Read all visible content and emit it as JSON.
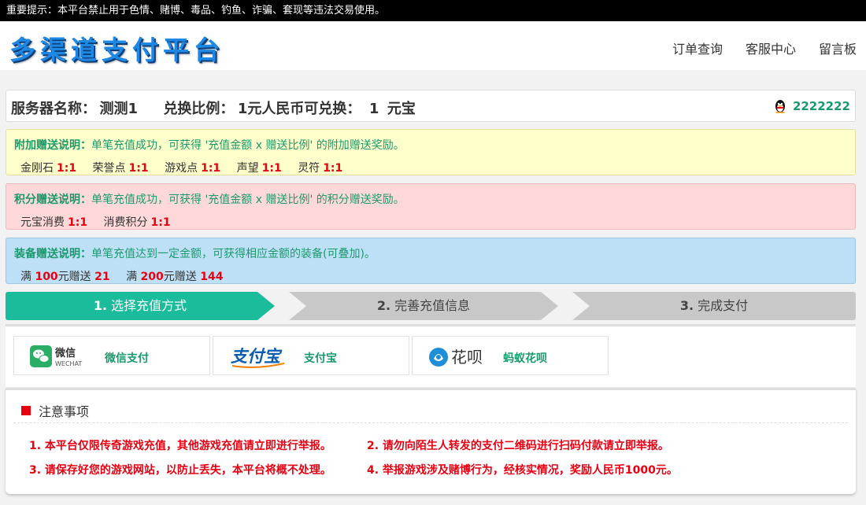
{
  "notice": "重要提示：本平台禁止用于色情、赌博、毒品、钓鱼、诈骗、套现等违法交易使用。",
  "header": {
    "logo": "多渠道支付平台",
    "nav": [
      "订单查询",
      "客服中心",
      "留言板"
    ]
  },
  "server": {
    "name_label": "服务器名称：",
    "name_value": "测测1",
    "ratio_label": "兑换比例：",
    "ratio_text": "1元人民币可兑换：",
    "ratio_value": "1",
    "ratio_unit": "元宝",
    "qq": "2222222"
  },
  "bonus_extra": {
    "title": "附加赠送说明：",
    "desc": "单笔充值成功，可获得 '充值金额 x 赠送比例' 的附加赠送奖励。",
    "items": [
      {
        "name": "金刚石",
        "ratio": "1:1"
      },
      {
        "name": "荣誉点",
        "ratio": "1:1"
      },
      {
        "name": "游戏点",
        "ratio": "1:1"
      },
      {
        "name": "声望",
        "ratio": "1:1"
      },
      {
        "name": "灵符",
        "ratio": "1:1"
      }
    ]
  },
  "bonus_points": {
    "title": "积分赠送说明：",
    "desc": "单笔充值成功，可获得 '充值金额 x 赠送比例' 的积分赠送奖励。",
    "items": [
      {
        "name": "元宝消费",
        "ratio": "1:1"
      },
      {
        "name": "消费积分",
        "ratio": "1:1"
      }
    ]
  },
  "bonus_equip": {
    "title": "装备赠送说明：",
    "desc": "单笔充值达到一定金额，可获得相应金额的装备(可叠加)。",
    "items": [
      {
        "pre": "满",
        "amount": "100",
        "mid": "元赠送",
        "gift": "21"
      },
      {
        "pre": "满",
        "amount": "200",
        "mid": "元赠送",
        "gift": "144"
      }
    ]
  },
  "steps": [
    {
      "num": "1.",
      "label": "选择充值方式"
    },
    {
      "num": "2.",
      "label": "完善充值信息"
    },
    {
      "num": "3.",
      "label": "完成支付"
    }
  ],
  "payments": [
    {
      "label": "微信支付",
      "logo_main": "微信",
      "logo_sub": "WECHAT"
    },
    {
      "label": "支付宝",
      "logo_main": "支付宝"
    },
    {
      "label": "蚂蚁花呗",
      "logo_main": "花呗"
    }
  ],
  "notes": {
    "title": "注意事项",
    "items": [
      "1. 本平台仅限传奇游戏充值，其他游戏充值请立即进行举报。",
      "2. 请勿向陌生人转发的支付二维码进行扫码付款请立即举报。",
      "3. 请保存好您的游戏网站，以防止丢失，本平台将概不处理。",
      "4. 举报游戏涉及赌博行为，经核实情况，奖励人民币1000元。"
    ]
  },
  "colors": {
    "accent": "#1abc9c",
    "red": "#e60012",
    "teal": "#1a9a6c"
  }
}
